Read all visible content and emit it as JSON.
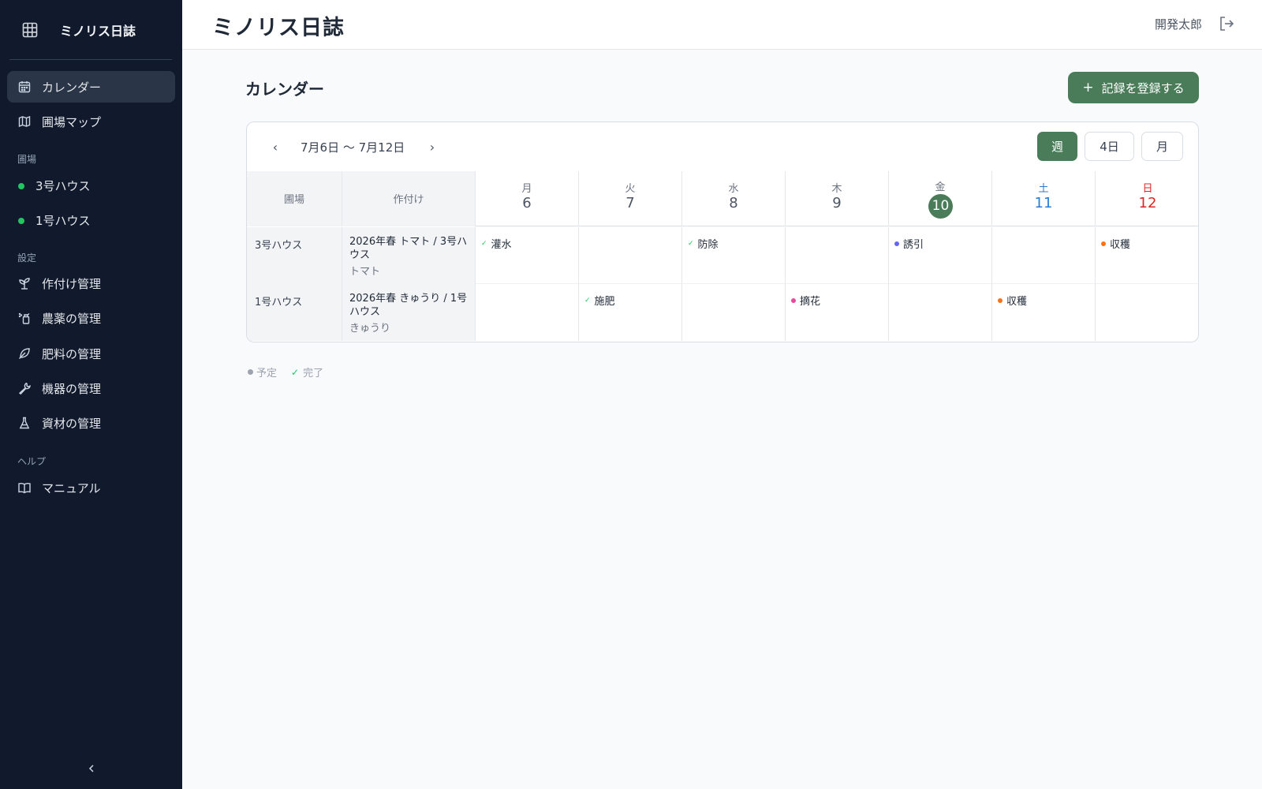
{
  "app": {
    "brand": "ミノリス日誌",
    "title": "ミノリス日誌",
    "user": "開発太郎"
  },
  "sidebar": {
    "top_items": [
      {
        "label": "カレンダー",
        "icon": "calendar-icon",
        "active": true
      },
      {
        "label": "圃場マップ",
        "icon": "map-icon",
        "active": false
      }
    ],
    "fields_section": "圃場",
    "fields": [
      {
        "label": "3号ハウス",
        "status_color": "#22c55e"
      },
      {
        "label": "1号ハウス",
        "status_color": "#22c55e"
      }
    ],
    "settings_section": "設定",
    "settings_items": [
      {
        "label": "作付け管理",
        "icon": "seedling-icon"
      },
      {
        "label": "農薬の管理",
        "icon": "spray-bottle-icon"
      },
      {
        "label": "肥料の管理",
        "icon": "leaf-icon"
      },
      {
        "label": "機器の管理",
        "icon": "wrench-icon"
      },
      {
        "label": "資材の管理",
        "icon": "flask-icon"
      }
    ],
    "help_section": "ヘルプ",
    "help_items": [
      {
        "label": "マニュアル",
        "icon": "book-icon"
      }
    ]
  },
  "main": {
    "page_title": "カレンダー",
    "add_button": "記録を登録する",
    "add_button_icon": "+"
  },
  "calendar": {
    "range": "7月6日 〜 7月12日",
    "prev": "‹",
    "next": "›",
    "views": [
      {
        "label": "週",
        "active": true
      },
      {
        "label": "4日",
        "active": false
      },
      {
        "label": "月",
        "active": false
      }
    ],
    "headers": {
      "field": "圃場",
      "crop": "作付け"
    },
    "days": [
      {
        "weekday": "月",
        "date": "6",
        "kind": "weekday"
      },
      {
        "weekday": "火",
        "date": "7",
        "kind": "weekday"
      },
      {
        "weekday": "水",
        "date": "8",
        "kind": "weekday"
      },
      {
        "weekday": "木",
        "date": "9",
        "kind": "weekday"
      },
      {
        "weekday": "金",
        "date": "10",
        "kind": "today"
      },
      {
        "weekday": "土",
        "date": "11",
        "kind": "sat"
      },
      {
        "weekday": "日",
        "date": "12",
        "kind": "sun"
      }
    ],
    "rows": [
      {
        "field": "3号ハウス",
        "crop_title": "2026年春 トマト / 3号ハウス",
        "crop_name": "トマト",
        "events": [
          {
            "day": 0,
            "label": "灌水",
            "status": "done",
            "color": "#22c55e"
          },
          {
            "day": 2,
            "label": "防除",
            "status": "done",
            "color": "#22c55e"
          },
          {
            "day": 4,
            "label": "誘引",
            "status": "planned",
            "color": "#6366f1"
          },
          {
            "day": 6,
            "label": "収穫",
            "status": "planned",
            "color": "#f97316"
          }
        ]
      },
      {
        "field": "1号ハウス",
        "crop_title": "2026年春 きゅうり / 1号ハウス",
        "crop_name": "きゅうり",
        "events": [
          {
            "day": 1,
            "label": "施肥",
            "status": "done",
            "color": "#22c55e"
          },
          {
            "day": 3,
            "label": "摘花",
            "status": "planned",
            "color": "#ec4899"
          },
          {
            "day": 5,
            "label": "収穫",
            "status": "planned",
            "color": "#f97316"
          }
        ]
      }
    ]
  },
  "legend": {
    "planned": "予定",
    "done": "完了"
  },
  "colors": {
    "accent": "#4a7c59",
    "sidebar_bg": "#101a2c",
    "saturday": "#2b7bd1",
    "sunday": "#dc2626"
  }
}
